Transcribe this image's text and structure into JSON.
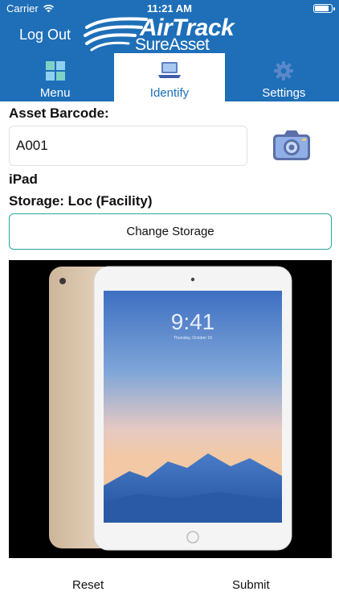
{
  "status_bar": {
    "carrier": "Carrier",
    "time": "11:21 AM"
  },
  "header": {
    "logout_label": "Log Out",
    "logo_line1": "AirTrack",
    "logo_line2": "SureAsset"
  },
  "tabs": [
    {
      "label": "Menu",
      "icon": "grid-icon",
      "active": false
    },
    {
      "label": "Identify",
      "icon": "laptop-icon",
      "active": true
    },
    {
      "label": "Settings",
      "icon": "gear-icon",
      "active": false
    }
  ],
  "form": {
    "barcode_label": "Asset Barcode:",
    "barcode_value": "A001",
    "asset_name": "iPad",
    "storage_text": "Storage: Loc (Facility)",
    "change_storage_label": "Change Storage"
  },
  "photo": {
    "device_time": "9:41",
    "device_date": "Thursday, October 16"
  },
  "footer": {
    "reset_label": "Reset",
    "submit_label": "Submit"
  },
  "colors": {
    "header_bg": "#1e6fb8",
    "accent_border": "#2aa59b",
    "tab_active_text": "#1e6fb8"
  }
}
